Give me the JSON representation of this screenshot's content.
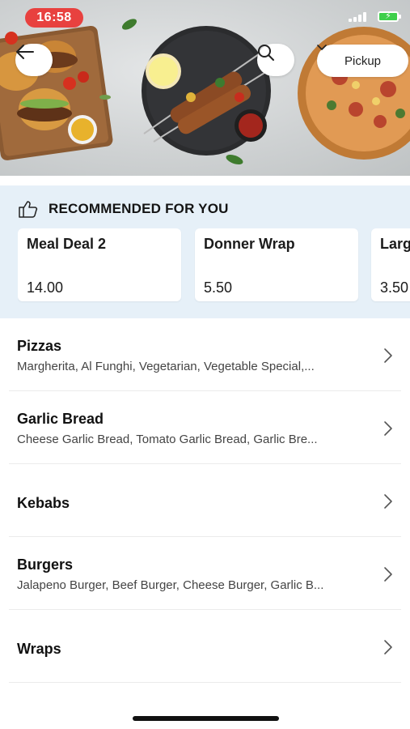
{
  "status_bar": {
    "time": "16:58"
  },
  "header": {
    "back_icon": "arrow-left-icon",
    "search_icon": "search-icon",
    "pickup_label": "Pickup",
    "pickup_icon": "chevron-down-icon"
  },
  "recommended": {
    "icon": "thumbs-up-icon",
    "title": "RECOMMENDED FOR YOU",
    "items": [
      {
        "name": "Meal Deal 2",
        "price": "14.00"
      },
      {
        "name": "Donner Wrap",
        "price": "5.50"
      },
      {
        "name": "Larg",
        "price": "3.50"
      }
    ]
  },
  "categories": [
    {
      "title": "Pizzas",
      "desc": "Margherita, Al Funghi, Vegetarian, Vegetable Special,..."
    },
    {
      "title": "Garlic Bread",
      "desc": "Cheese Garlic Bread, Tomato Garlic Bread, Garlic Bre..."
    },
    {
      "title": "Kebabs",
      "desc": ""
    },
    {
      "title": "Burgers",
      "desc": "Jalapeno Burger, Beef Burger, Cheese Burger, Garlic B..."
    },
    {
      "title": "Wraps",
      "desc": ""
    }
  ],
  "colors": {
    "time_badge": "#e8413f",
    "rec_bg": "#e6f0f8",
    "battery": "#3ecf4b"
  }
}
